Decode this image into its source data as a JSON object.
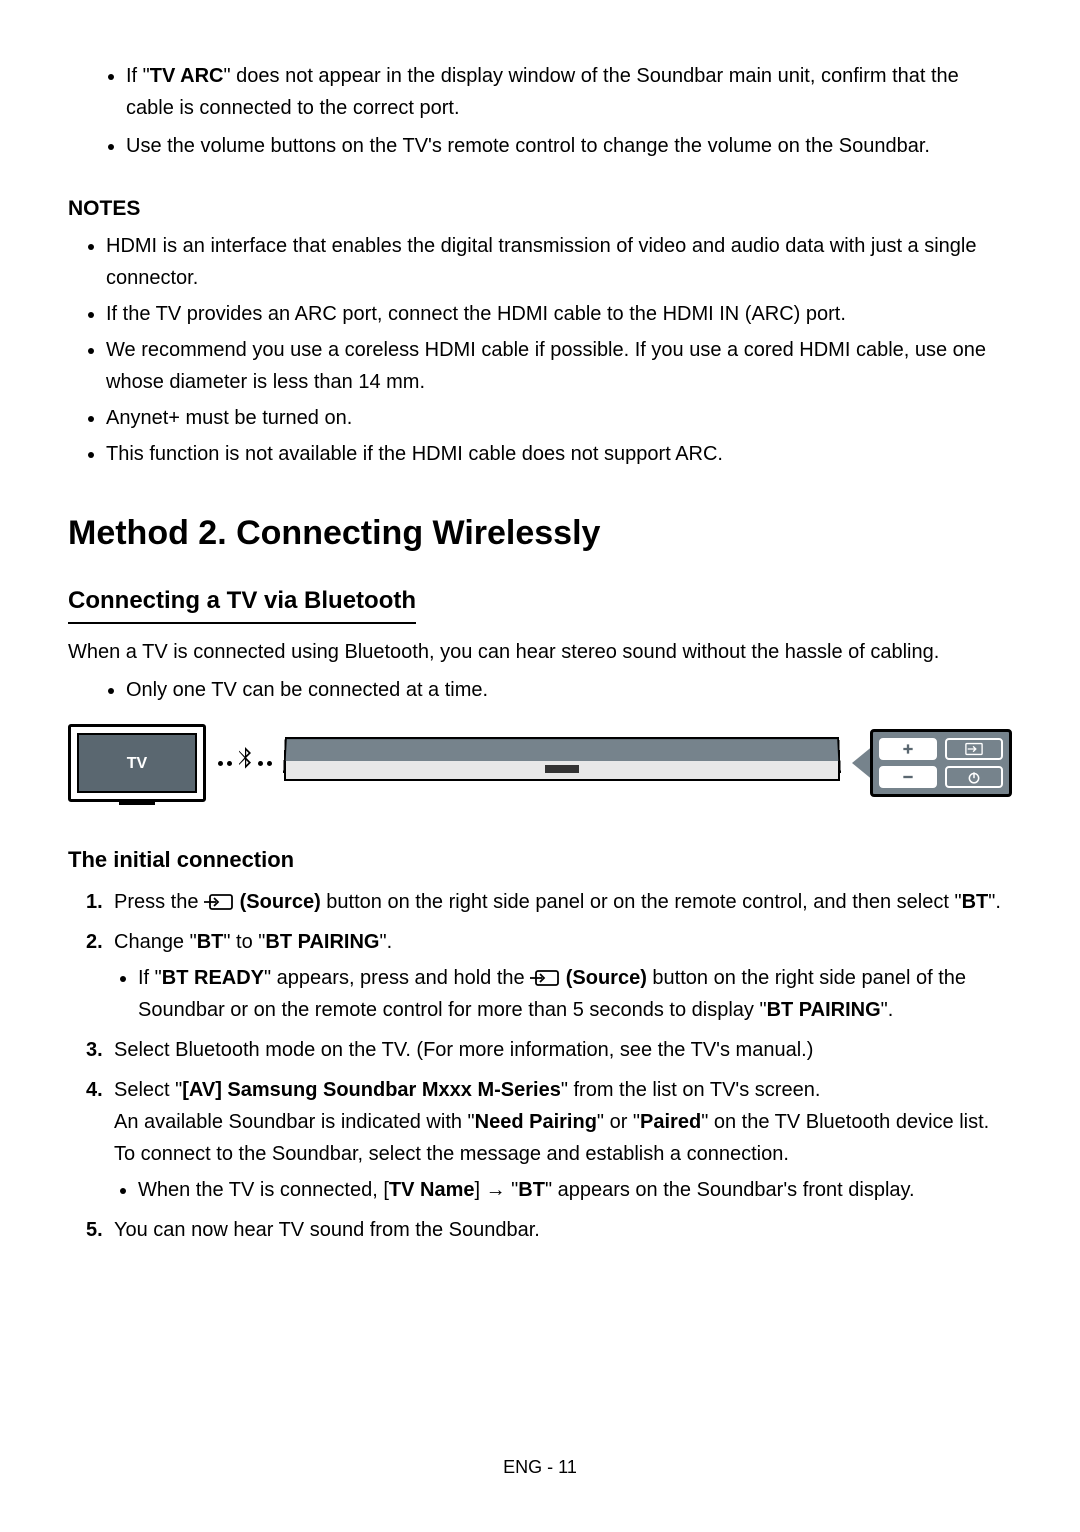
{
  "topBullets": {
    "b1_pre": "If \"",
    "b1_bold": "TV ARC",
    "b1_post": "\" does not appear in the display window of the Soundbar main unit, confirm that the cable is connected to the correct port.",
    "b2": "Use the volume buttons on the TV's remote control to change the volume on the Soundbar."
  },
  "notesHeading": "NOTES",
  "notes": {
    "n1": "HDMI is an interface that enables the digital transmission of video and audio data with just a single connector.",
    "n2": "If the TV provides an ARC port, connect the HDMI cable to the HDMI IN (ARC) port.",
    "n3": "We recommend you use a coreless HDMI cable if possible. If you use a cored HDMI cable, use one whose diameter is less than 14 mm.",
    "n4": "Anynet+ must be turned on.",
    "n5": "This function is not available if the HDMI cable does not support ARC."
  },
  "h1": "Method 2. Connecting Wirelessly",
  "h2": "Connecting a TV via Bluetooth",
  "intro": "When a TV is connected using Bluetooth, you can hear stereo sound without the hassle of cabling.",
  "introBullet": "Only one TV can be connected at a time.",
  "tvLabel": "TV",
  "h3": "The initial connection",
  "steps": {
    "s1_a": "Press the ",
    "s1_bold": " (Source)",
    "s1_b": " button on the right side panel or on the remote control, and then select \"",
    "s1_bold2": "BT",
    "s1_c": "\".",
    "s2_a": "Change \"",
    "s2_b1": "BT",
    "s2_b": "\" to \"",
    "s2_b2": "BT PAIRING",
    "s2_c": "\".",
    "s2_sub_a": "If \"",
    "s2_sub_b1": "BT READY",
    "s2_sub_b": "\" appears, press and hold the ",
    "s2_sub_bold": " (Source)",
    "s2_sub_c": " button on the right side panel of the Soundbar or on the remote control for more than 5 seconds to display \"",
    "s2_sub_b2": "BT PAIRING",
    "s2_sub_d": "\".",
    "s3": "Select Bluetooth mode on the TV. (For more information, see the TV's manual.)",
    "s4_a": "Select \"",
    "s4_b1": "[AV] Samsung Soundbar Mxxx M-Series",
    "s4_b": "\" from the list on TV's screen.",
    "s4_l2a": "An available Soundbar is indicated with \"",
    "s4_l2b1": "Need Pairing",
    "s4_l2b": "\" or \"",
    "s4_l2b2": "Paired",
    "s4_l2c": "\" on the TV Bluetooth device list. To connect to the Soundbar, select the message and establish a connection.",
    "s4_sub_a": "When the TV is connected, [",
    "s4_sub_b1": "TV Name",
    "s4_sub_b": "] → \"",
    "s4_sub_b2": "BT",
    "s4_sub_c": "\" appears on the Soundbar's front display.",
    "s5": "You can now hear TV sound from the Soundbar."
  },
  "footer": "ENG - 11",
  "icons": {
    "source": "source-icon",
    "bluetooth": "bluetooth-icon",
    "plus": "plus-icon",
    "minus": "minus-icon",
    "input": "input-icon",
    "power": "power-icon"
  }
}
